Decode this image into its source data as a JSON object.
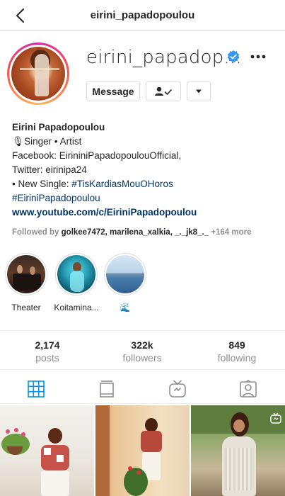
{
  "header": {
    "title": "eirini_papadopoulou"
  },
  "profile": {
    "username_display": "eirini_papadop...",
    "message_label": "Message",
    "full_name": "Eirini Papadopoulou",
    "bio_line1": "🎙Singer • Artist",
    "bio_line2": "Facebook: EirininiPapadopoulouOfficial,",
    "bio_line3": "Twitter: eirinipa24",
    "bio_line4_prefix": "• New Single: ",
    "bio_line4_tag": "#TisKardiasMouOHoros",
    "bio_line5_tag": "#EiriniPapadopoulou",
    "website": "www.youtube.com/c/EiriniPapadopoulou"
  },
  "followed_by": {
    "prefix": "Followed by ",
    "names": "golkee7472, marilena_xalkia, _._jk8_._",
    "more": " +164 more"
  },
  "highlights": [
    {
      "label": "Theater"
    },
    {
      "label": "Koitamina..."
    },
    {
      "label": "🌊"
    }
  ],
  "stats": [
    {
      "value": "2,174",
      "label": "posts"
    },
    {
      "value": "322k",
      "label": "followers"
    },
    {
      "value": "849",
      "label": "following"
    }
  ],
  "colors": {
    "link": "#00376b",
    "verified": "#3897f0",
    "active_tab": "#0095f6",
    "muted": "#8e8e8e"
  },
  "icons": {
    "back": "chevron-left-icon",
    "verified": "verified-badge-icon",
    "more": "more-options-icon",
    "follow": "following-check-icon",
    "dropdown": "caret-down-icon",
    "grid": "grid-icon",
    "feed": "feed-icon",
    "igtv": "igtv-icon",
    "tagged": "tagged-icon"
  }
}
